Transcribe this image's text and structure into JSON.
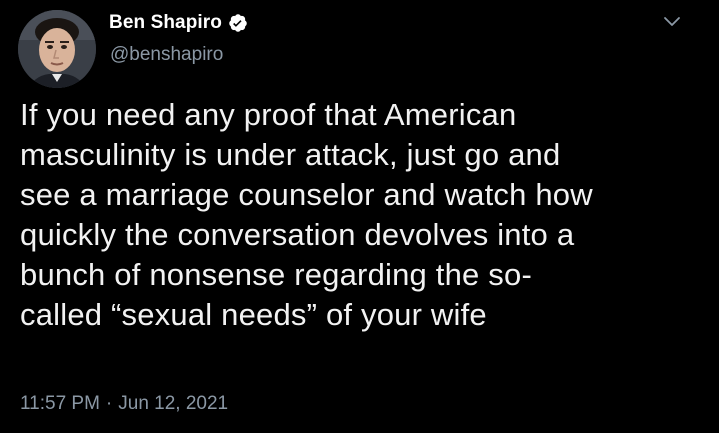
{
  "tweet": {
    "author": {
      "display_name": "Ben Shapiro",
      "handle": "@benshapiro",
      "verified": true
    },
    "lines": [
      "If you need any proof that American",
      "masculinity is under attack, just go and",
      "see a marriage counselor and watch how",
      "quickly the conversation devolves into a",
      "bunch of nonsense regarding the so-",
      "called “sexual needs” of your wife"
    ],
    "time": "11:57 PM",
    "separator": "·",
    "date": "Jun 12, 2021",
    "icons": {
      "avatar": "profile-photo",
      "verified": "verified-badge-icon",
      "menu": "chevron-down-icon"
    },
    "colors": {
      "background": "#000000",
      "text": "#f2f2f2",
      "muted": "#8b98a5",
      "verified_badge": "#ffffff"
    }
  }
}
